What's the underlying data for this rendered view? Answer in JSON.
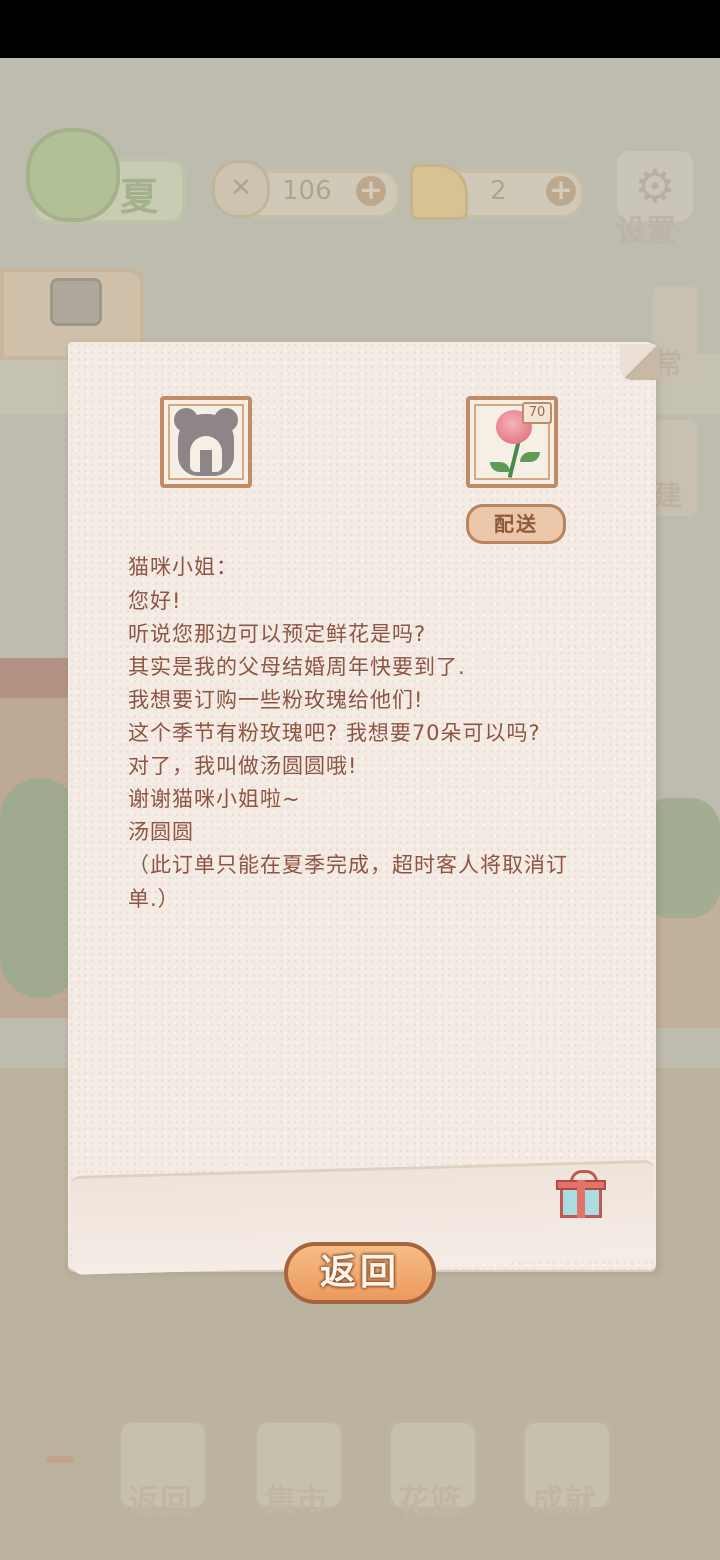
{
  "hud": {
    "season": "夏",
    "fish_count": "106",
    "cheese_count": "2",
    "plus": "+",
    "settings_label": "设置",
    "side_labels": [
      "常",
      "建"
    ]
  },
  "letter": {
    "rose_quantity": "70",
    "deliver_label": "配送",
    "lines": [
      "猫咪小姐：",
      "您好!",
      "听说您那边可以预定鲜花是吗?",
      "其实是我的父母结婚周年快要到了.",
      "我想要订购一些粉玫瑰给他们!",
      "这个季节有粉玫瑰吧? 我想要70朵可以吗?",
      "对了，我叫做汤圆圆哦!",
      "谢谢猫咪小姐啦~",
      "汤圆圆",
      "（此订单只能在夏季完成，超时客人将取消订单.）"
    ],
    "back_label": "返回"
  },
  "bottom_nav": {
    "items": [
      "返回",
      "集市",
      "花篮",
      "成就"
    ]
  },
  "colors": {
    "paper": "#f4ebe5",
    "text": "#8d5542",
    "accent_orange": "#ec9a5e",
    "frame_brown": "#c08b67"
  },
  "icons": [
    "fish-icon",
    "cheese-icon",
    "gear-icon",
    "bag-icon",
    "customer-avatar",
    "pink-rose-icon",
    "gift-icon"
  ]
}
